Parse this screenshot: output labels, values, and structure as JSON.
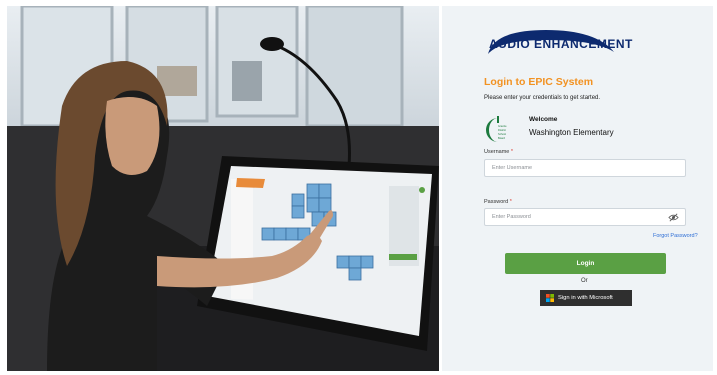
{
  "brand": {
    "name": "AUDIO ENHANCEMENT"
  },
  "login": {
    "title": "Login to EPIC System",
    "subtitle": "Please enter your credentials to get started.",
    "welcome_label": "Welcome",
    "school_name": "Washington Elementary",
    "school_logo_text": [
      "Granite",
      "District",
      "School",
      "Board"
    ],
    "username_label": "Username",
    "username_placeholder": "Enter Username",
    "password_label": "Password",
    "password_placeholder": "Enter Password",
    "required_mark": "*",
    "forgot_password": "Forgot Password?",
    "login_button": "Login",
    "or_text": "Or",
    "microsoft_button": "Sign in with Microsoft"
  },
  "colors": {
    "accent": "#f29222",
    "login_button": "#5aa044",
    "link": "#2f6fd6",
    "brand_navy": "#0d2a6f",
    "panel_bg": "#eff3f6"
  },
  "icons": [
    "eye-slash-icon",
    "microsoft-logo-icon"
  ]
}
